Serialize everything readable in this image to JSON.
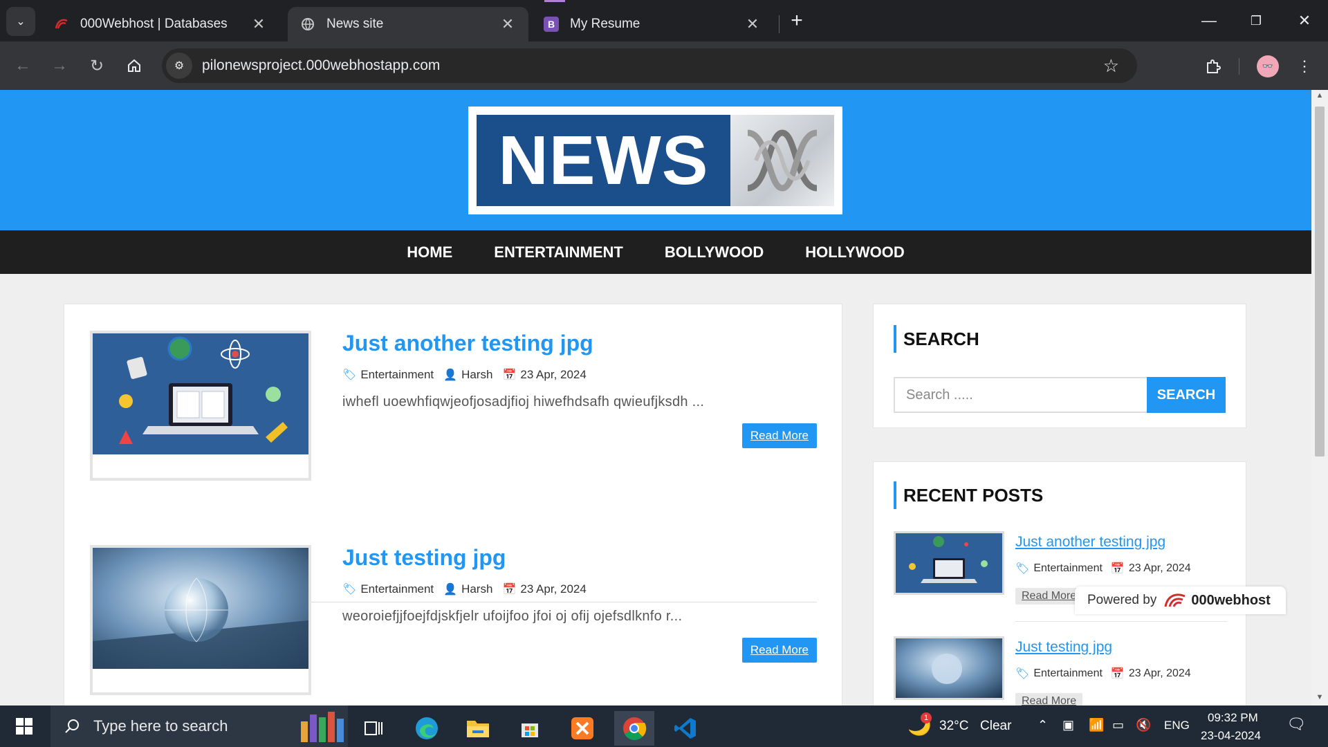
{
  "browser": {
    "tabs": [
      {
        "title": "000Webhost | Databases",
        "icon": "000webhost-icon"
      },
      {
        "title": "News site",
        "icon": "globe-icon"
      },
      {
        "title": "My Resume",
        "icon": "bootstrap-icon"
      }
    ],
    "url": "pilonewsproject.000webhostapp.com"
  },
  "site": {
    "logo_text": "NEWS",
    "nav": [
      "HOME",
      "ENTERTAINMENT",
      "BOLLYWOOD",
      "HOLLYWOOD"
    ],
    "posts": [
      {
        "title": "Just another testing jpg",
        "category": "Entertainment",
        "author": "Harsh",
        "date": "23 Apr, 2024",
        "excerpt": "iwhefl uoewhfiqwjeofjosadjfioj hiwefhdsafh qwieufjksdh ...",
        "read_more": "Read More"
      },
      {
        "title": "Just testing jpg",
        "category": "Entertainment",
        "author": "Harsh",
        "date": "23 Apr, 2024",
        "excerpt": "weoroiefjjfoejfdjskfjelr ufoijfoo jfoi oj ofij ojefsdlknfo r...",
        "read_more": "Read More"
      }
    ],
    "sidebar": {
      "search_heading": "SEARCH",
      "search_placeholder": "Search .....",
      "search_button": "SEARCH",
      "recent_heading": "RECENT POSTS",
      "recent": [
        {
          "title": "Just another testing jpg",
          "category": "Entertainment",
          "date": "23 Apr, 2024",
          "read_more": "Read More"
        },
        {
          "title": "Just testing jpg",
          "category": "Entertainment",
          "date": "23 Apr, 2024",
          "read_more": "Read More"
        }
      ]
    },
    "powered": {
      "label": "Powered by",
      "brand": "000webhost"
    }
  },
  "taskbar": {
    "search_placeholder": "Type here to search",
    "weather": {
      "temp": "32°C",
      "condition": "Clear",
      "badge": "1"
    },
    "language": "ENG",
    "time": "09:32 PM",
    "date": "23-04-2024"
  },
  "colors": {
    "accent": "#2196f3",
    "nav_bg": "#1f1f1f",
    "taskbar_bg": "#202a36"
  }
}
